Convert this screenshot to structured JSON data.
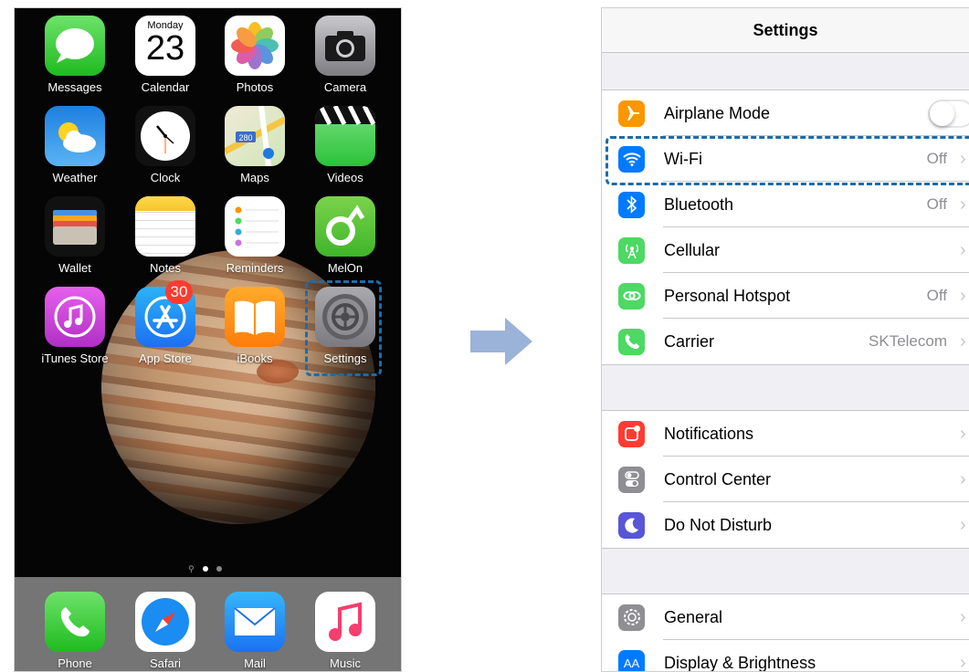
{
  "home": {
    "apps": [
      {
        "label": "Messages",
        "icon": "messages-icon"
      },
      {
        "label": "Calendar",
        "icon": "calendar-icon",
        "weekday": "Monday",
        "day": "23"
      },
      {
        "label": "Photos",
        "icon": "photos-icon"
      },
      {
        "label": "Camera",
        "icon": "camera-icon"
      },
      {
        "label": "Weather",
        "icon": "weather-icon"
      },
      {
        "label": "Clock",
        "icon": "clock-icon"
      },
      {
        "label": "Maps",
        "icon": "maps-icon",
        "route": "280"
      },
      {
        "label": "Videos",
        "icon": "videos-icon"
      },
      {
        "label": "Wallet",
        "icon": "wallet-icon"
      },
      {
        "label": "Notes",
        "icon": "notes-icon"
      },
      {
        "label": "Reminders",
        "icon": "reminders-icon"
      },
      {
        "label": "MelOn",
        "icon": "melon-icon"
      },
      {
        "label": "iTunes Store",
        "icon": "itunes-store-icon"
      },
      {
        "label": "App Store",
        "icon": "app-store-icon",
        "badge": "30"
      },
      {
        "label": "iBooks",
        "icon": "ibooks-icon"
      },
      {
        "label": "Settings",
        "icon": "settings-gear-icon"
      }
    ],
    "dock": [
      {
        "label": "Phone",
        "icon": "phone-icon"
      },
      {
        "label": "Safari",
        "icon": "safari-icon"
      },
      {
        "label": "Mail",
        "icon": "mail-icon"
      },
      {
        "label": "Music",
        "icon": "music-icon"
      }
    ],
    "page_indicator": {
      "pages": 2,
      "current": 1
    }
  },
  "settings": {
    "title": "Settings",
    "rows": [
      {
        "label": "Airplane Mode",
        "value": "",
        "icon": "airplane-icon",
        "color": "#ff9500",
        "toggle": false
      },
      {
        "label": "Wi-Fi",
        "value": "Off",
        "icon": "wifi-icon",
        "color": "#007aff"
      },
      {
        "label": "Bluetooth",
        "value": "Off",
        "icon": "bluetooth-icon",
        "color": "#007aff"
      },
      {
        "label": "Cellular",
        "value": "",
        "icon": "cellular-icon",
        "color": "#4cd964"
      },
      {
        "label": "Personal Hotspot",
        "value": "Off",
        "icon": "hotspot-icon",
        "color": "#4cd964"
      },
      {
        "label": "Carrier",
        "value": "SKTelecom",
        "icon": "carrier-phone-icon",
        "color": "#4cd964"
      },
      {
        "label": "Notifications",
        "value": "",
        "icon": "notifications-icon",
        "color": "#ff3b30"
      },
      {
        "label": "Control Center",
        "value": "",
        "icon": "control-center-icon",
        "color": "#8e8e93"
      },
      {
        "label": "Do Not Disturb",
        "value": "",
        "icon": "moon-icon",
        "color": "#5856d6"
      },
      {
        "label": "General",
        "value": "",
        "icon": "gear-icon",
        "color": "#8e8e93"
      },
      {
        "label": "Display & Brightness",
        "value": "",
        "icon": "display-brightness-icon",
        "color": "#007aff",
        "glyph": "AA"
      }
    ]
  },
  "colors": {
    "highlight": "#1b6ca8",
    "arrow": "#9bb3d9"
  }
}
